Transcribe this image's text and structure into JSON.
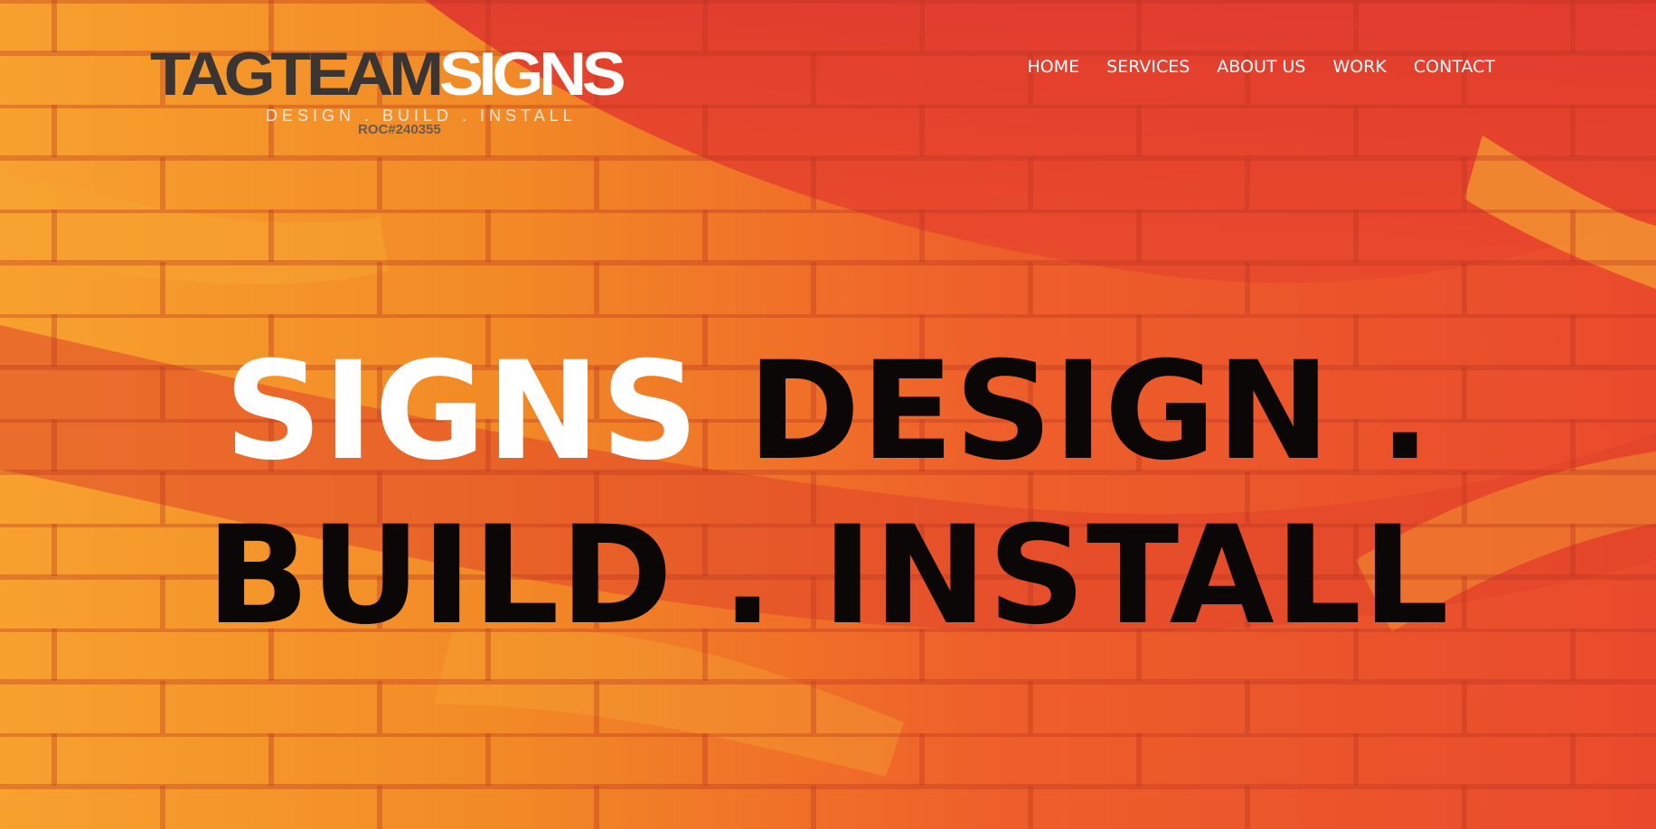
{
  "brand": {
    "name_part1": "TAGTEAM",
    "name_part2": "SIGNS",
    "tagline": "DESIGN . BUILD . INSTALL",
    "license": "ROC#240355"
  },
  "nav": {
    "items": [
      {
        "label": "HOME"
      },
      {
        "label": "SERVICES"
      },
      {
        "label": "ABOUT US"
      },
      {
        "label": "WORK"
      },
      {
        "label": "CONTACT"
      }
    ]
  },
  "hero": {
    "headline_highlight": "SIGNS",
    "headline_line1_rest": "DESIGN .",
    "headline_line2": "BUILD . INSTALL"
  },
  "colors": {
    "logo_dark": "#3a3432",
    "headline_dark": "#0b0707",
    "white": "#ffffff",
    "brick_red": "#e8442e",
    "brick_orange": "#f79a2a"
  }
}
